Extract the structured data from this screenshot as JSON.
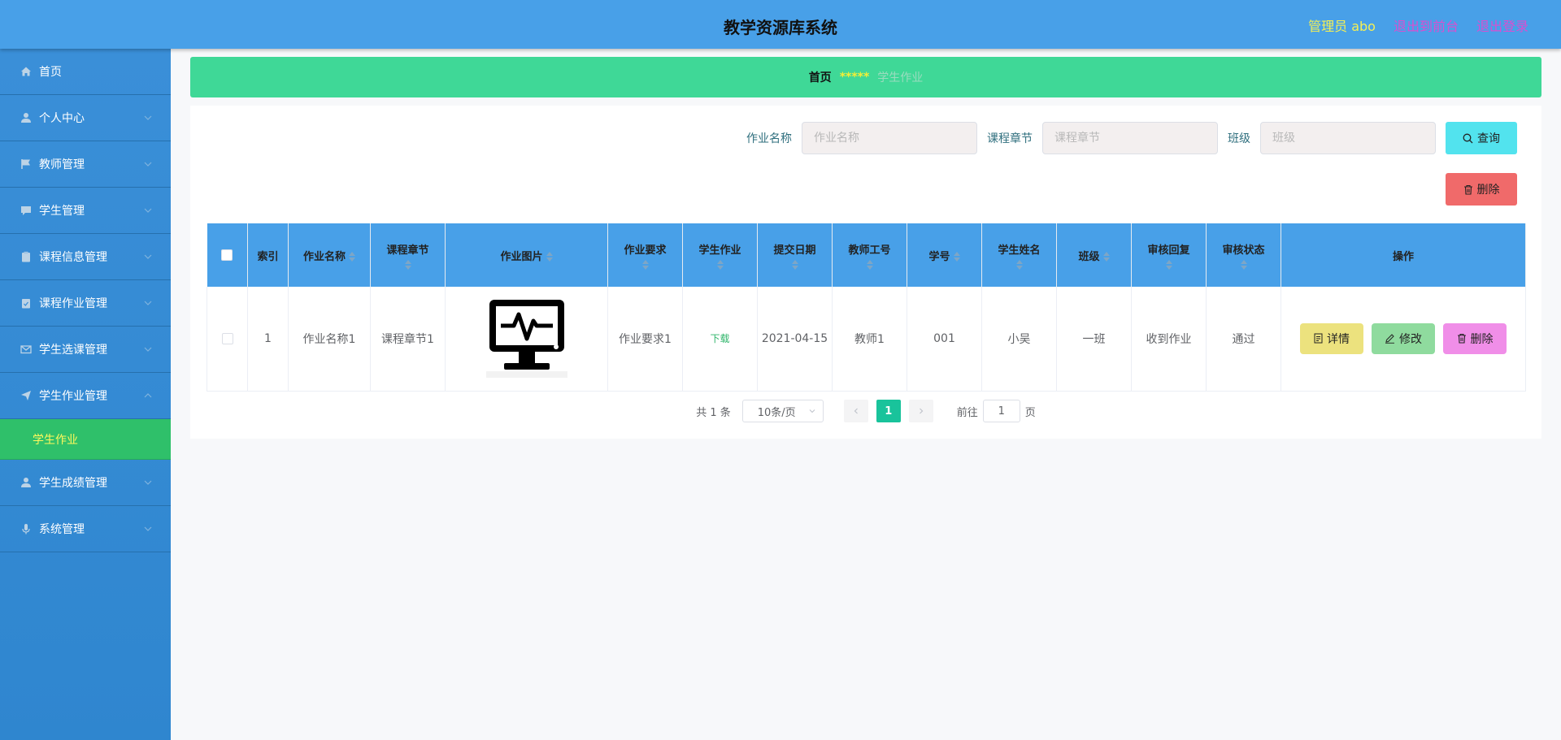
{
  "header": {
    "title": "教学资源库系统",
    "admin": "管理员 abo",
    "back_to_front": "退出到前台",
    "logout": "退出登录"
  },
  "sidebar": {
    "items": [
      {
        "label": "首页",
        "icon": "home-icon"
      },
      {
        "label": "个人中心",
        "icon": "user-icon"
      },
      {
        "label": "教师管理",
        "icon": "flag-icon"
      },
      {
        "label": "学生管理",
        "icon": "chat-icon"
      },
      {
        "label": "课程信息管理",
        "icon": "clipboard-icon"
      },
      {
        "label": "课程作业管理",
        "icon": "clipboard-check-icon"
      },
      {
        "label": "学生选课管理",
        "icon": "mail-icon"
      },
      {
        "label": "学生作业管理",
        "icon": "send-icon"
      },
      {
        "label": "学生成绩管理",
        "icon": "user-icon"
      },
      {
        "label": "系统管理",
        "icon": "microphone-icon"
      }
    ],
    "active_sub": "学生作业"
  },
  "breadcrumb": {
    "home": "首页",
    "separator": "*****",
    "current": "学生作业"
  },
  "search": {
    "name_label": "作业名称",
    "name_placeholder": "作业名称",
    "chapter_label": "课程章节",
    "chapter_placeholder": "课程章节",
    "class_label": "班级",
    "class_placeholder": "班级",
    "query_button": "查询",
    "delete_button": "删除"
  },
  "table": {
    "headers": [
      "索引",
      "作业名称",
      "课程章节",
      "作业图片",
      "作业要求",
      "学生作业",
      "提交日期",
      "教师工号",
      "学号",
      "学生姓名",
      "班级",
      "审核回复",
      "审核状态",
      "操作"
    ],
    "rows": [
      {
        "index": "1",
        "name": "作业名称1",
        "chapter": "课程章节1",
        "requirement": "作业要求1",
        "homework": "下载",
        "date": "2021-04-15",
        "teacher_id": "教师1",
        "student_no": "001",
        "student_name": "小吴",
        "class": "一班",
        "reply": "收到作业",
        "status": "通过",
        "detail_label": "详情",
        "edit_label": "修改",
        "delete_label": "删除"
      }
    ]
  },
  "pager": {
    "total": "共 1 条",
    "page_size": "10条/页",
    "current_page": "1",
    "goto_label": "前往",
    "goto_value": "1",
    "page_unit": "页"
  }
}
